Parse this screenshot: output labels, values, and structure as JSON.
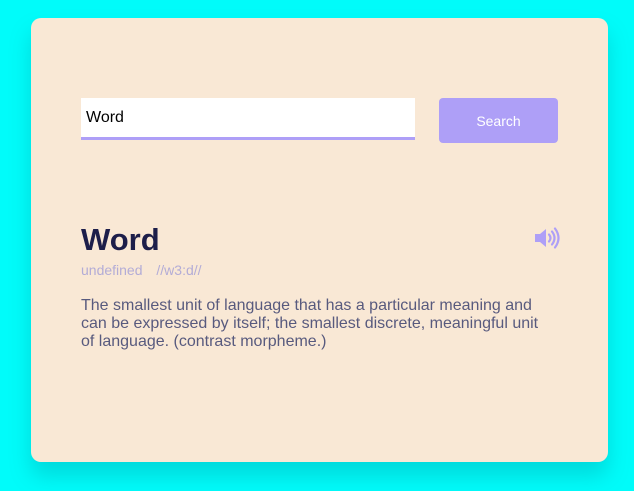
{
  "search": {
    "value": "Word",
    "button_label": "Search"
  },
  "result": {
    "word": "Word",
    "part_of_speech": "undefined",
    "phonetic": "//w3:d//",
    "definition": "The smallest unit of language that has a particular meaning and can be expressed by itself; the smallest discrete, meaningful unit of language. (contrast morpheme.)",
    "audio_icon": "speaker-volume-icon"
  },
  "colors": {
    "background": "#00fcfa",
    "card": "#f9e8d5",
    "accent": "#ae9ff7",
    "title": "#1d1e4a",
    "muted": "#b3acd6",
    "body_text": "#585a7e"
  }
}
